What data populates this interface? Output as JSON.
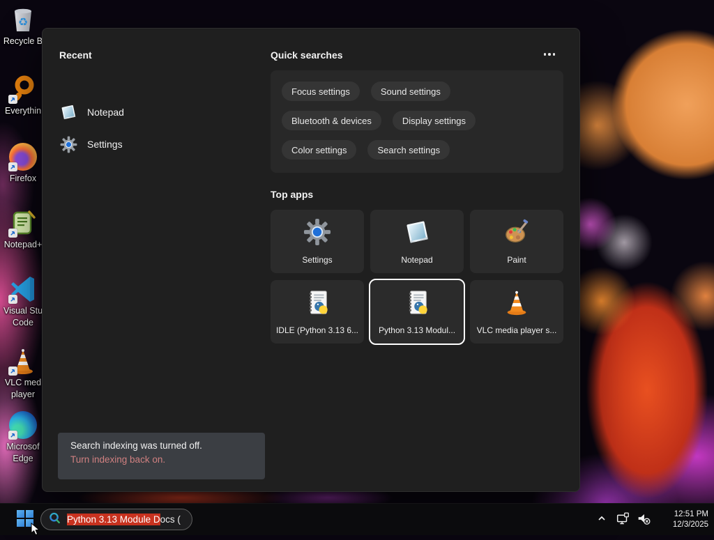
{
  "desktop": {
    "icons": [
      {
        "label": "Recycle B",
        "label2": ""
      },
      {
        "label": "Everythin",
        "label2": ""
      },
      {
        "label": "Firefox",
        "label2": ""
      },
      {
        "label": "Notepad+",
        "label2": ""
      },
      {
        "label": "Visual Stu",
        "label2": "Code"
      },
      {
        "label": "VLC med",
        "label2": "player"
      },
      {
        "label": "Microsof",
        "label2": "Edge"
      }
    ]
  },
  "search_panel": {
    "recent": {
      "title": "Recent",
      "items": [
        {
          "label": "Notepad"
        },
        {
          "label": "Settings"
        }
      ]
    },
    "quick_searches": {
      "title": "Quick searches",
      "pills": [
        "Focus settings",
        "Sound settings",
        "Bluetooth & devices",
        "Display settings",
        "Color settings",
        "Search settings"
      ]
    },
    "top_apps": {
      "title": "Top apps",
      "tiles": [
        {
          "label": "Settings"
        },
        {
          "label": "Notepad"
        },
        {
          "label": "Paint"
        },
        {
          "label": "IDLE (Python 3.13 6..."
        },
        {
          "label": "Python 3.13 Modul..."
        },
        {
          "label": "VLC media player s..."
        }
      ]
    },
    "notice": {
      "line1": "Search indexing was turned off.",
      "line2": "Turn indexing back on."
    }
  },
  "taskbar": {
    "search": {
      "selected_text": "Python 3.13 Module D",
      "rest_text": "ocs ("
    },
    "clock": {
      "time": "12:51 PM",
      "date": "12/3/2025"
    }
  },
  "colors": {
    "accent_blue": "#4cc2ff",
    "selection_red": "#c8321f",
    "notice_link": "#d08080",
    "panel_bg": "#1f1f1f",
    "tile_bg": "#2b2b2b"
  }
}
